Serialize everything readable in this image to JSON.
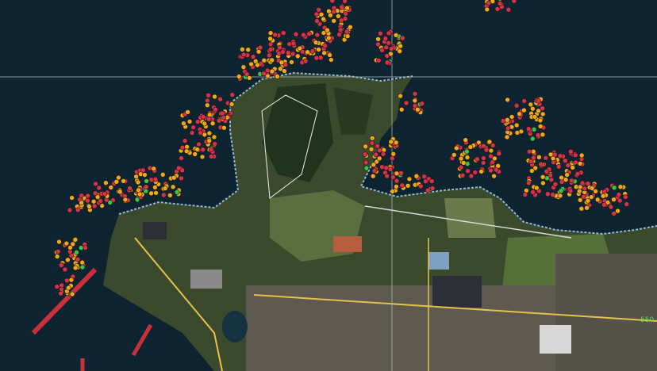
{
  "map": {
    "kind": "aerial-imagery-with-point-symbols",
    "colors": {
      "water": "#0f2431",
      "land": "#3a4a2b",
      "shoreline": "#8fb8d6",
      "marker_red": "#d8314a",
      "marker_orange": "#f0a816",
      "marker_green": "#34c94a",
      "pier": "#c9303a",
      "road": "#e6c24a",
      "crosshair": "#b7c3cc"
    },
    "marker_legend": [
      "marker-red",
      "marker-orange",
      "marker-green"
    ],
    "corner_label": "550"
  }
}
